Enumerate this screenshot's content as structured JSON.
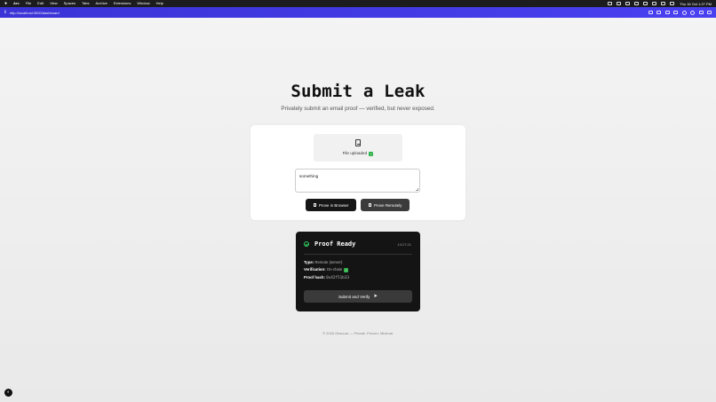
{
  "menubar": {
    "app": "Arc",
    "items": [
      "File",
      "Edit",
      "View",
      "Spaces",
      "Tabs",
      "Archive",
      "Extensions",
      "Window",
      "Help"
    ],
    "clock": "Thu 16 Oct  1:27 PM"
  },
  "browser": {
    "url": "http://localhost:3000/dashboard",
    "accent": "#4a40f0"
  },
  "page": {
    "title": "Submit a Leak",
    "subtitle": "Privately submit an email proof — verified, but never exposed.",
    "upload_status": "File uploaded",
    "textarea_value": "something",
    "prove_browser_label": "Prove in Browser",
    "prove_remote_label": "Prove Remotely"
  },
  "proof": {
    "title": "Proof Ready",
    "time": "13:27:21",
    "type_label": "Type:",
    "type_value": "Remote (server)",
    "verification_label": "Verification:",
    "verification_value": "On-chain",
    "hash_label": "Proof hash:",
    "hash_value": "0x42f51b33",
    "submit_label": "Submit and Verify"
  },
  "footer": "© 2025 Obscura — Private. Proven. Minimal."
}
